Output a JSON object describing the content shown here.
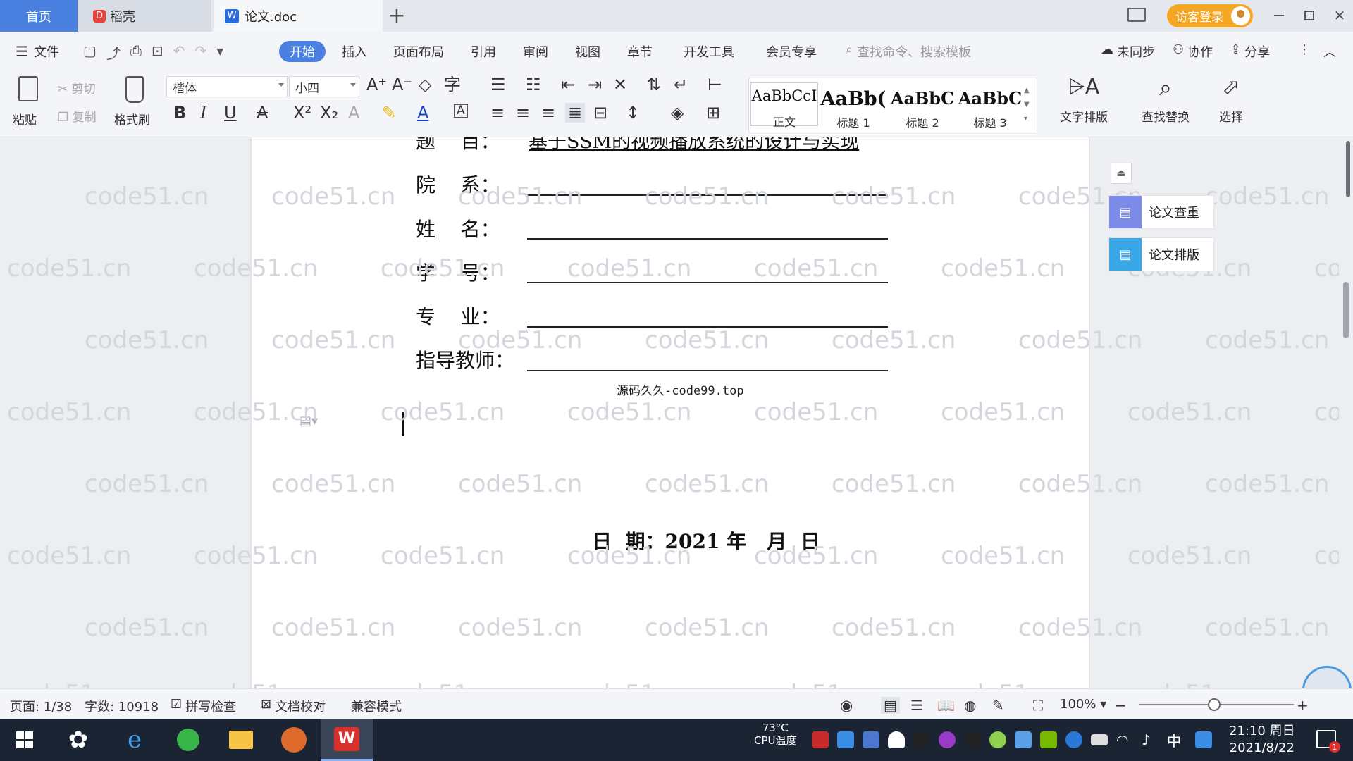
{
  "tabs": {
    "home": "首页",
    "daoke": "稻壳",
    "doc": "论文.doc",
    "add": "+"
  },
  "login_label": "访客登录",
  "menu": {
    "file": "文件",
    "items": [
      "开始",
      "插入",
      "页面布局",
      "引用",
      "审阅",
      "视图",
      "章节",
      "开发工具",
      "会员专享"
    ],
    "search_placeholder": "查找命令、搜索模板",
    "sync": "未同步",
    "collab": "协作",
    "share": "分享"
  },
  "ribbon": {
    "paste": "粘贴",
    "cut": "剪切",
    "copy": "复制",
    "format_painter": "格式刷",
    "font_name": "楷体",
    "font_size": "小四",
    "styles": [
      {
        "preview": "AaBbCcI",
        "label": "正文"
      },
      {
        "preview": "AaBb(",
        "label": "标题 1"
      },
      {
        "preview": "AaBbC",
        "label": "标题 2"
      },
      {
        "preview": "AaBbC",
        "label": "标题 3"
      }
    ],
    "text_layout": "文字排版",
    "find_replace": "查找替换",
    "select": "选择"
  },
  "document": {
    "title_label": "题    目：",
    "title_value": "基于SSM的视频播放系统的设计与实现",
    "fields": [
      {
        "label": "院    系："
      },
      {
        "label": "姓    名："
      },
      {
        "label": "学    号："
      },
      {
        "label": "专    业："
      },
      {
        "label": "指导教师："
      }
    ],
    "source_note": "源码久久-code99.top",
    "date_line": "日  期：2021 年   月  日"
  },
  "watermark": "code51.cn",
  "right_panel": {
    "check": "论文查重",
    "layout": "论文排版"
  },
  "status": {
    "page": "页面: 1/38",
    "words": "字数: 10918",
    "spell": "拼写检查",
    "proof": "文档校对",
    "compat": "兼容模式",
    "zoom": "100%"
  },
  "taskbar": {
    "temp": "73°C",
    "cpu": "CPU温度",
    "ime": "中",
    "time": "21:10 周日",
    "date": "2021/8/22",
    "notif_count": "1"
  },
  "colors": {
    "accent": "#4a80e0",
    "login": "#f5a623",
    "taskbar": "#1b2433"
  }
}
